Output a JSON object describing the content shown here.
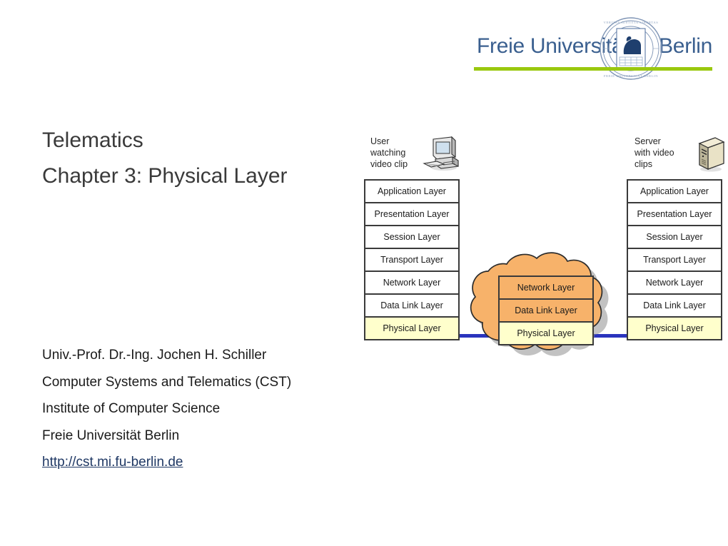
{
  "logo": {
    "left_word": "Freie Universität",
    "right_word": "Berlin",
    "seal_motto": "VERITAS IUSTITIA LIBERTAS",
    "seal_sub": "FREIE UNIVERSITÄT BERLIN",
    "rule_color": "#9ac80f",
    "text_color": "#3a5f8f"
  },
  "title": {
    "line1": "Telematics",
    "line2": "Chapter 3: Physical Layer"
  },
  "author": {
    "line1": "Univ.-Prof. Dr.-Ing. Jochen H. Schiller",
    "line2": "Computer Systems and Telematics (CST)",
    "line3": "Institute of Computer Science",
    "line4": "Freie Universität Berlin",
    "url": "http://cst.mi.fu-berlin.de",
    "url_color": "#1f3864"
  },
  "diagram": {
    "client": {
      "caption_line1": "User",
      "caption_line2": "watching",
      "caption_line3": "video clip",
      "icon": "desktop-computer-icon",
      "layers": [
        {
          "label": "Application Layer",
          "highlight": false
        },
        {
          "label": "Presentation Layer",
          "highlight": false
        },
        {
          "label": "Session Layer",
          "highlight": false
        },
        {
          "label": "Transport Layer",
          "highlight": false
        },
        {
          "label": "Network Layer",
          "highlight": false
        },
        {
          "label": "Data Link Layer",
          "highlight": false
        },
        {
          "label": "Physical Layer",
          "highlight": true
        }
      ]
    },
    "server": {
      "caption_line1": "Server",
      "caption_line2": "with video",
      "caption_line3": "clips",
      "icon": "server-tower-icon",
      "layers": [
        {
          "label": "Application Layer",
          "highlight": false
        },
        {
          "label": "Presentation Layer",
          "highlight": false
        },
        {
          "label": "Session Layer",
          "highlight": false
        },
        {
          "label": "Transport Layer",
          "highlight": false
        },
        {
          "label": "Network Layer",
          "highlight": false
        },
        {
          "label": "Data Link Layer",
          "highlight": false
        },
        {
          "label": "Physical Layer",
          "highlight": true
        }
      ]
    },
    "network_cloud": {
      "icon": "network-cloud-icon",
      "fill_color": "#f7b26a",
      "layers": [
        {
          "label": "Network Layer",
          "highlight": false
        },
        {
          "label": "Data Link Layer",
          "highlight": false
        },
        {
          "label": "Physical Layer",
          "highlight": true
        }
      ]
    },
    "link_color": "#2a34bd",
    "highlight_color": "#ffffcc"
  }
}
